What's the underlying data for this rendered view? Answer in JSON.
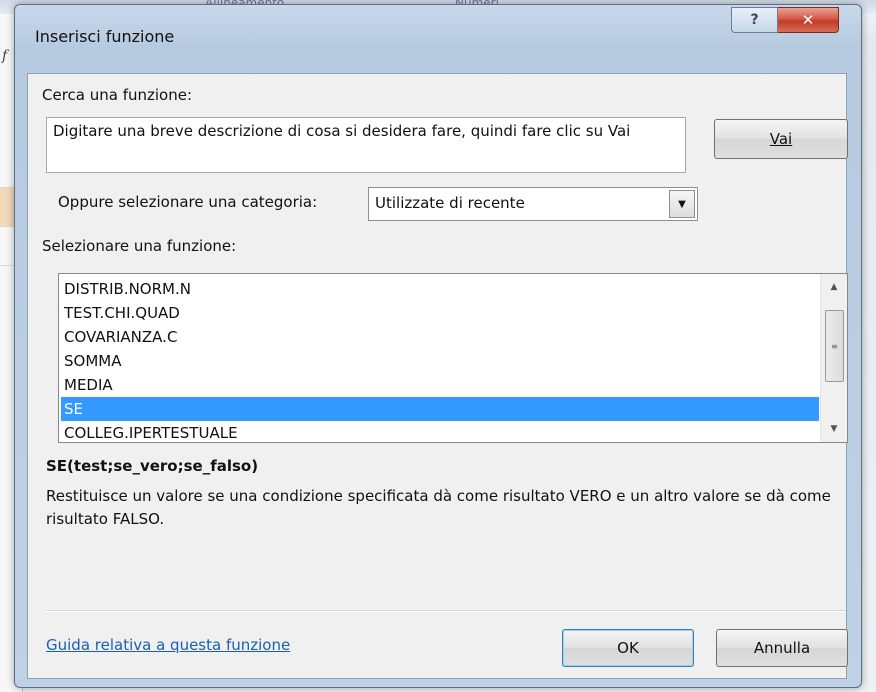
{
  "background": {
    "ribbon_labels": [
      "Allineamento",
      "Numeri"
    ],
    "formula_icon": "fx-icon"
  },
  "dialog": {
    "title": "Inserisci funzione",
    "help_icon": "question-icon",
    "close_icon": "close-icon",
    "search_label": "Cerca una funzione:",
    "search_value": "Digitare una breve descrizione di cosa si desidera fare, quindi fare clic su Vai",
    "go_button": "Vai",
    "category_label": "Oppure selezionare una categoria:",
    "category_value": "Utilizzate di recente",
    "functions_label": "Selezionare una funzione:",
    "functions": [
      "DISTRIB.NORM.N",
      "TEST.CHI.QUAD",
      "COVARIANZA.C",
      "SOMMA",
      "MEDIA",
      "SE",
      "COLLEG.IPERTESTUALE"
    ],
    "selected_function": "SE",
    "syntax": "SE(test;se_vero;se_falso)",
    "description": "Restituisce un valore se una condizione specificata dà come risultato VERO e un altro valore se dà come risultato FALSO.",
    "help_link": "Guida relativa a questa funzione",
    "ok_button": "OK",
    "cancel_button": "Annulla"
  },
  "colors": {
    "selection": "#3399ff",
    "link": "#1a5fb4",
    "close_button": "#c23a25"
  }
}
